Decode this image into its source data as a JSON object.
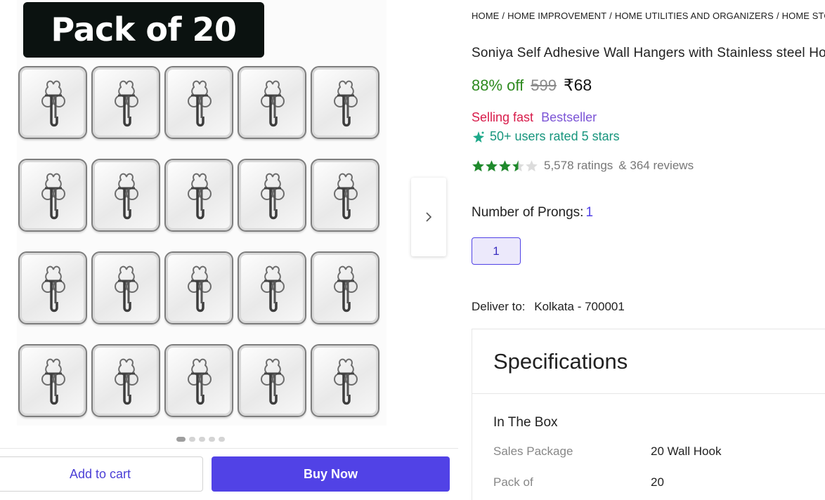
{
  "gallery": {
    "banner_text": "Pack of 20",
    "hook_count": 20,
    "slide_count": 5,
    "active_slide": 1,
    "next_icon": "chevron-right-icon"
  },
  "actions": {
    "add_to_cart": "Add to cart",
    "buy_now": "Buy Now"
  },
  "breadcrumb": [
    "HOME",
    "HOME IMPROVEMENT",
    "HOME UTILITIES AND ORGANIZERS",
    "HOME STORAGE"
  ],
  "product": {
    "title": "Soniya Self Adhesive Wall Hangers with Stainless steel Hooks",
    "discount": "88% off",
    "mrp": "599",
    "price": "₹68",
    "badge_selling": "Selling fast",
    "badge_best": "Bestseller",
    "rated_text": "50+ users rated 5 stars",
    "stars_value": 3.5,
    "stars_max": 5,
    "ratings": "5,578 ratings",
    "reviews": "& 364 reviews"
  },
  "variant": {
    "label": "Number of Prongs:",
    "selected": "1",
    "option": "1"
  },
  "delivery": {
    "label": "Deliver to:",
    "location": "Kolkata - 700001"
  },
  "specs": {
    "heading": "Specifications",
    "group": "In The Box",
    "rows": [
      {
        "key": "Sales Package",
        "value": "20 Wall Hook"
      },
      {
        "key": "Pack of",
        "value": "20"
      }
    ]
  },
  "colors": {
    "accent": "#5142e6",
    "discount": "#2e8a1f",
    "selling_fast": "#d81b4a",
    "bestseller": "#7b54d6",
    "rated": "#17957d",
    "star": "#1f8a2c"
  }
}
